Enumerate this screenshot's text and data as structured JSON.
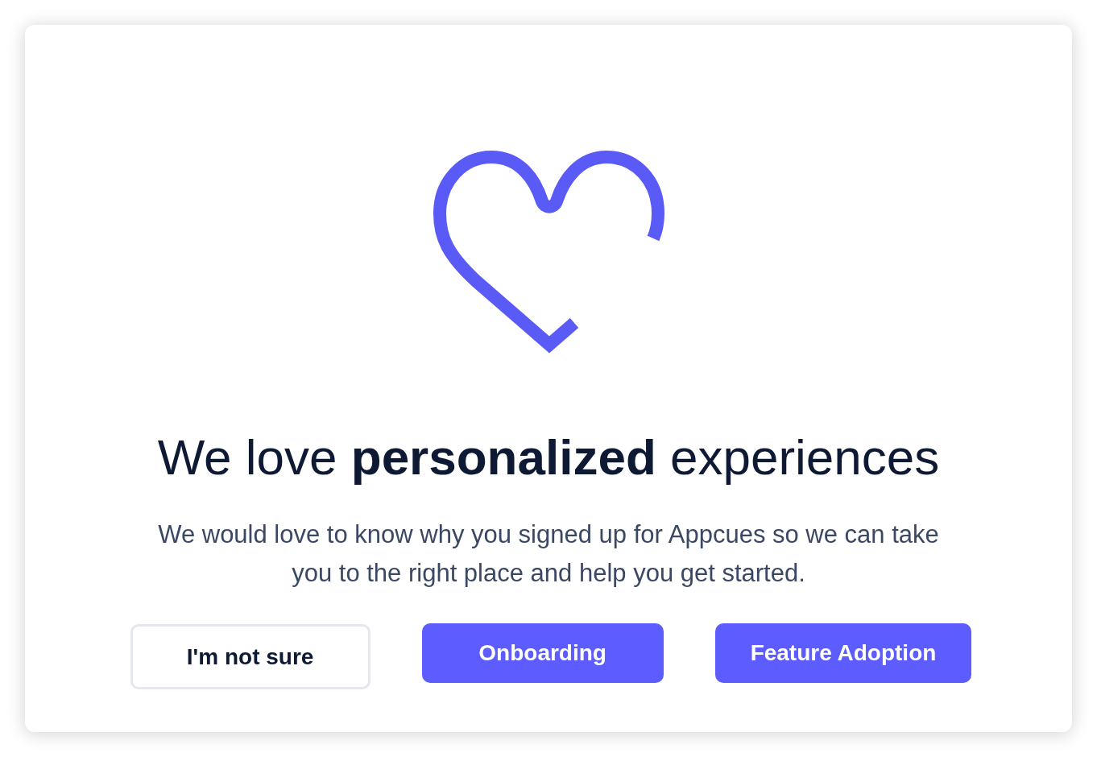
{
  "dialog": {
    "heading": "We love **personalized** experiences",
    "description": "We would love to know why you signed up for Appcues so we can take you to the right place and help you get started.",
    "buttons": [
      {
        "label": "I'm not sure",
        "kind": "secondary"
      },
      {
        "label": "Onboarding",
        "kind": "primary"
      },
      {
        "label": "Feature Adoption",
        "kind": "primary"
      }
    ]
  }
}
